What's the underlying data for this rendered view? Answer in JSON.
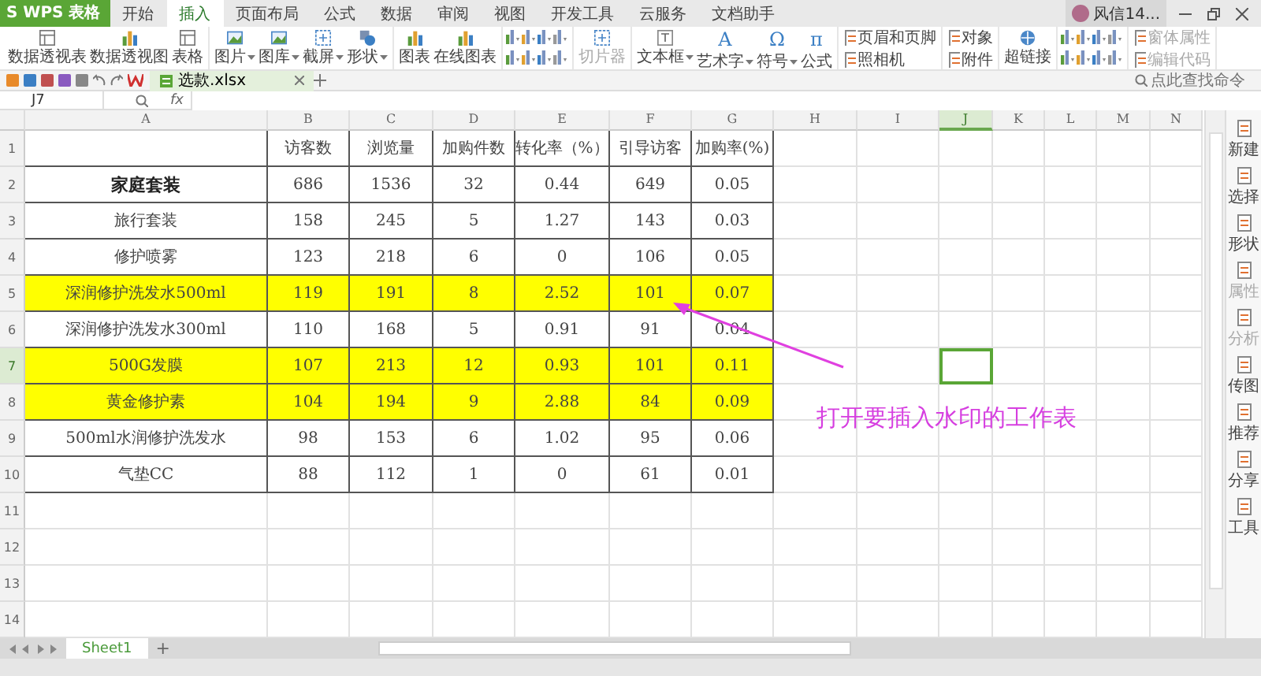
{
  "app": {
    "logo": "S WPS 表格"
  },
  "menu_tabs": [
    {
      "label": "开始",
      "selected": false
    },
    {
      "label": "插入",
      "selected": true
    },
    {
      "label": "页面布局",
      "selected": false
    },
    {
      "label": "公式",
      "selected": false
    },
    {
      "label": "数据",
      "selected": false
    },
    {
      "label": "审阅",
      "selected": false
    },
    {
      "label": "视图",
      "selected": false
    },
    {
      "label": "开发工具",
      "selected": false
    },
    {
      "label": "云服务",
      "selected": false
    },
    {
      "label": "文档助手",
      "selected": false
    }
  ],
  "user": {
    "name": "风信14..."
  },
  "ribbon": {
    "groups": [
      {
        "kind": "large",
        "items": [
          {
            "label": "数据透视表",
            "dropdown": false,
            "disabled": false
          },
          {
            "label": "数据透视图",
            "dropdown": false,
            "disabled": false
          },
          {
            "label": "表格",
            "dropdown": false,
            "disabled": false
          }
        ]
      },
      {
        "kind": "large",
        "items": [
          {
            "label": "图片",
            "dropdown": true,
            "disabled": false
          },
          {
            "label": "图库",
            "dropdown": true,
            "disabled": false
          },
          {
            "label": "截屏",
            "dropdown": true,
            "disabled": false
          },
          {
            "label": "形状",
            "dropdown": true,
            "disabled": false
          }
        ]
      },
      {
        "kind": "large",
        "items": [
          {
            "label": "图表",
            "dropdown": false,
            "disabled": false
          },
          {
            "label": "在线图表",
            "dropdown": false,
            "disabled": false
          }
        ]
      },
      {
        "kind": "drawing"
      },
      {
        "kind": "large",
        "items": [
          {
            "label": "切片器",
            "dropdown": false,
            "disabled": true
          }
        ]
      },
      {
        "kind": "large",
        "items": [
          {
            "label": "文本框",
            "dropdown": true,
            "disabled": false
          },
          {
            "label": "艺术字",
            "dropdown": true,
            "disabled": false,
            "glyph": "A"
          },
          {
            "label": "符号",
            "dropdown": true,
            "disabled": false,
            "glyph": "Ω"
          },
          {
            "label": "公式",
            "dropdown": false,
            "disabled": false,
            "glyph": "π"
          }
        ]
      },
      {
        "kind": "stack",
        "items": [
          {
            "label": "页眉和页脚",
            "disabled": false
          },
          {
            "label": "照相机",
            "disabled": false
          }
        ]
      },
      {
        "kind": "stack",
        "items": [
          {
            "label": "对象",
            "disabled": false
          },
          {
            "label": "附件",
            "disabled": false
          }
        ]
      },
      {
        "kind": "large",
        "items": [
          {
            "label": "超链接",
            "dropdown": false,
            "disabled": false
          }
        ]
      },
      {
        "kind": "drawing"
      },
      {
        "kind": "stack",
        "items": [
          {
            "label": "窗体属性",
            "disabled": true
          },
          {
            "label": "编辑代码",
            "disabled": true
          }
        ]
      }
    ]
  },
  "doc_tab": {
    "title": "选款.xlsx"
  },
  "command_search": {
    "placeholder": "点此查找命令"
  },
  "formula_bar": {
    "cell": "J7",
    "fx": "fx"
  },
  "columns": [
    {
      "label": "A",
      "selected": false
    },
    {
      "label": "B",
      "selected": false
    },
    {
      "label": "C",
      "selected": false
    },
    {
      "label": "D",
      "selected": false
    },
    {
      "label": "E",
      "selected": false
    },
    {
      "label": "F",
      "selected": false
    },
    {
      "label": "G",
      "selected": false
    },
    {
      "label": "H",
      "selected": false
    },
    {
      "label": "I",
      "selected": false
    },
    {
      "label": "J",
      "selected": true
    },
    {
      "label": "K",
      "selected": false
    },
    {
      "label": "L",
      "selected": false
    },
    {
      "label": "M",
      "selected": false
    },
    {
      "label": "N",
      "selected": false
    }
  ],
  "rows": [
    {
      "number": "1",
      "kind": "header",
      "selected": false,
      "cells": [
        "访客数",
        "浏览量",
        "加购件数",
        "转化率（%）",
        "引导访客",
        "加购率(%)"
      ]
    },
    {
      "number": "2",
      "kind": "data",
      "selected": false,
      "highlighted": false,
      "bold": true,
      "label": "家庭套装",
      "cells": [
        "686",
        "1536",
        "32",
        "0.44",
        "649",
        "0.05"
      ]
    },
    {
      "number": "3",
      "kind": "data",
      "selected": false,
      "highlighted": false,
      "bold": false,
      "label": "旅行套装",
      "cells": [
        "158",
        "245",
        "5",
        "1.27",
        "143",
        "0.03"
      ]
    },
    {
      "number": "4",
      "kind": "data",
      "selected": false,
      "highlighted": false,
      "bold": false,
      "label": "修护喷雾",
      "cells": [
        "123",
        "218",
        "6",
        "0",
        "106",
        "0.05"
      ]
    },
    {
      "number": "5",
      "kind": "data",
      "selected": false,
      "highlighted": true,
      "bold": false,
      "label": "深润修护洗发水500ml",
      "cells": [
        "119",
        "191",
        "8",
        "2.52",
        "101",
        "0.07"
      ]
    },
    {
      "number": "6",
      "kind": "data",
      "selected": false,
      "highlighted": false,
      "bold": false,
      "label": "深润修护洗发水300ml",
      "cells": [
        "110",
        "168",
        "5",
        "0.91",
        "91",
        "0.04"
      ]
    },
    {
      "number": "7",
      "kind": "data",
      "selected": true,
      "highlighted": true,
      "bold": false,
      "label": "500G发膜",
      "cells": [
        "107",
        "213",
        "12",
        "0.93",
        "101",
        "0.11"
      ]
    },
    {
      "number": "8",
      "kind": "data",
      "selected": false,
      "highlighted": true,
      "bold": false,
      "label": "黄金修护素",
      "cells": [
        "104",
        "194",
        "9",
        "2.88",
        "84",
        "0.09"
      ]
    },
    {
      "number": "9",
      "kind": "data",
      "selected": false,
      "highlighted": false,
      "bold": false,
      "label": "500ml水润修护洗发水",
      "cells": [
        "98",
        "153",
        "6",
        "1.02",
        "95",
        "0.06"
      ]
    },
    {
      "number": "10",
      "kind": "data",
      "selected": false,
      "highlighted": false,
      "bold": false,
      "label": "气垫CC",
      "cells": [
        "88",
        "112",
        "1",
        "0",
        "61",
        "0.01"
      ]
    },
    {
      "number": "11",
      "kind": "empty",
      "selected": false
    },
    {
      "number": "12",
      "kind": "empty",
      "selected": false
    },
    {
      "number": "13",
      "kind": "empty",
      "selected": false
    },
    {
      "number": "14",
      "kind": "empty",
      "selected": false
    }
  ],
  "annotation": {
    "text": "打开要插入水印的工作表"
  },
  "side_panel": [
    {
      "label": "新建",
      "disabled": false
    },
    {
      "label": "选择",
      "disabled": false
    },
    {
      "label": "形状",
      "disabled": false
    },
    {
      "label": "属性",
      "disabled": true
    },
    {
      "label": "分析",
      "disabled": true
    },
    {
      "label": "传图",
      "disabled": false
    },
    {
      "label": "推荐",
      "disabled": false
    },
    {
      "label": "分享",
      "disabled": false
    },
    {
      "label": "工具",
      "disabled": false
    }
  ],
  "sheet_tabs": [
    {
      "label": "Sheet1",
      "selected": true
    }
  ],
  "add_sheet": "+"
}
